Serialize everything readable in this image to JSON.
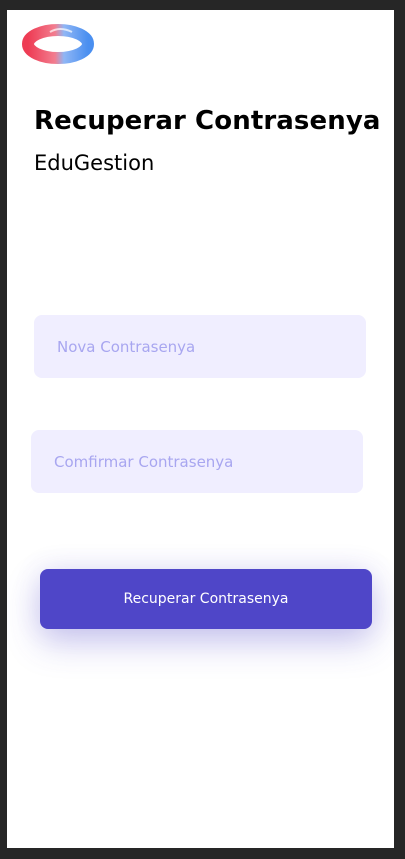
{
  "app": {
    "title": "Recuperar Contrasenya",
    "subtitle": "EduGestion",
    "logo_icon": "loop-logo-icon"
  },
  "form": {
    "new_password_placeholder": "Nova Contrasenya",
    "confirm_password_placeholder": "Comfirmar Contrasenya",
    "submit_label": "Recuperar Contrasenya"
  },
  "colors": {
    "accent": "#4f46c8",
    "field_background": "#f0eeff",
    "placeholder": "#a8a6f0",
    "logo_red": "#ee3c54",
    "logo_blue": "#4a8ff0"
  }
}
